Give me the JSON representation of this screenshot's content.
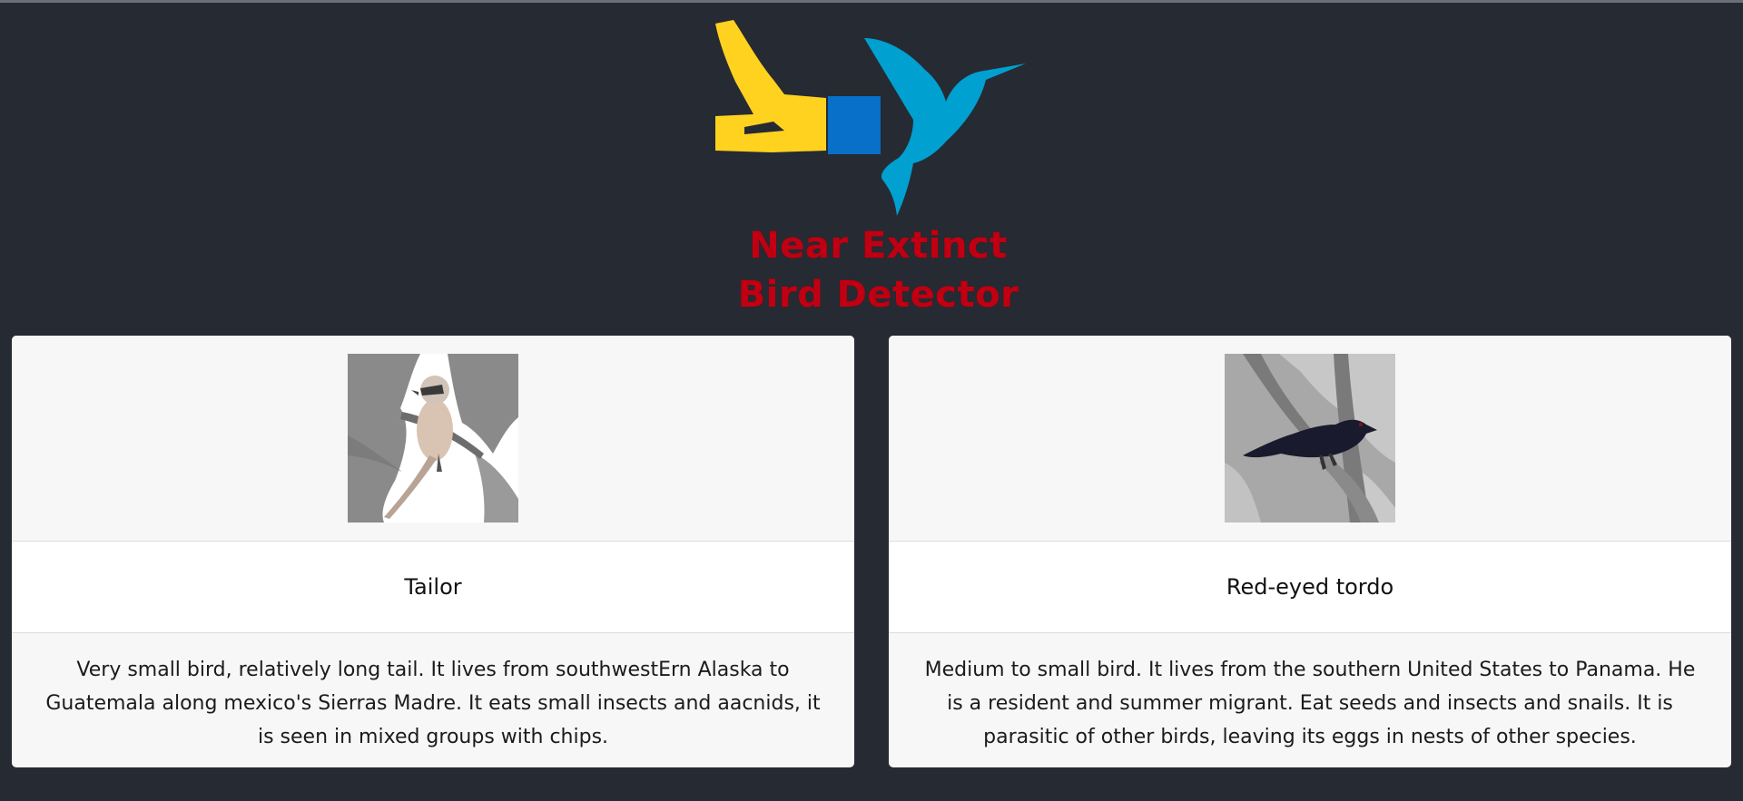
{
  "header": {
    "title_line1": "Near Extinct",
    "title_line2": "Bird Detector",
    "logo_icon": "bird-detector-logo-icon",
    "colors": {
      "background": "#262a33",
      "title": "#c00012",
      "logo_yellow": "#ffd21f",
      "logo_blue_square": "#0870c8",
      "logo_hummingbird": "#00a0d0"
    }
  },
  "cards": [
    {
      "name": "Tailor",
      "description": "Very small bird, relatively long tail. It lives from southwestErn Alaska to Guatemala along mexico's Sierras Madre. It eats small insects and aacnids, it is seen in mixed groups with chips.",
      "image_icon": "tailor-bird-photo"
    },
    {
      "name": "Red-eyed tordo",
      "description": "Medium to small bird. It lives from the southern United States to Panama. He is a resident and summer migrant. Eat seeds and insects and snails. It is parasitic of other birds, leaving its eggs in nests of other species.",
      "image_icon": "red-eyed-tordo-photo"
    }
  ]
}
